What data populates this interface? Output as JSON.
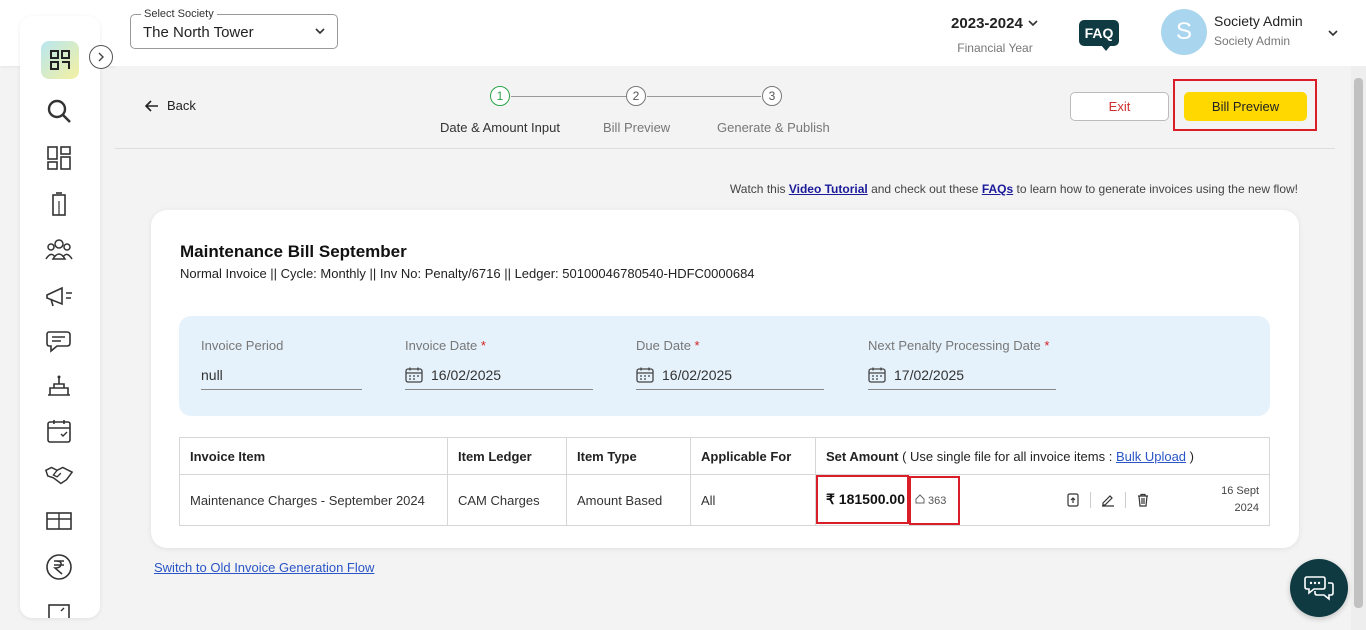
{
  "header": {
    "society_label": "Select Society",
    "society_value": "The North Tower",
    "financial_year": "2023-2024",
    "financial_year_label": "Financial Year",
    "faq_label": "FAQ",
    "avatar_letter": "S",
    "user_name": "Society Admin",
    "user_role": "Society Admin"
  },
  "sidebar": {
    "icons": [
      "search-icon",
      "dashboard-icon",
      "building-icon",
      "people-icon",
      "announcement-icon",
      "chat-icon",
      "amenity-icon",
      "calendar-icon",
      "handshake-icon",
      "parcel-icon",
      "rupee-icon",
      "more-icon"
    ]
  },
  "nav": {
    "back_label": "Back",
    "steps": [
      {
        "number": "1",
        "label": "Date & Amount Input"
      },
      {
        "number": "2",
        "label": "Bill Preview"
      },
      {
        "number": "3",
        "label": "Generate & Publish"
      }
    ],
    "exit_label": "Exit",
    "bill_preview_label": "Bill Preview"
  },
  "tutorial": {
    "prefix": "Watch this ",
    "video_link": "Video Tutorial",
    "middle": " and check out these ",
    "faq_link": "FAQs",
    "suffix": " to learn how to generate invoices using the new flow!"
  },
  "invoice": {
    "title": "Maintenance Bill September",
    "subtitle": "Normal Invoice || Cycle: Monthly || Inv No: Penalty/6716 || Ledger: 50100046780540-HDFC0000684",
    "fields": {
      "period_label": "Invoice Period",
      "period_value": "null",
      "invoice_date_label": "Invoice Date",
      "invoice_date_value": "16/02/2025",
      "due_date_label": "Due Date",
      "due_date_value": "16/02/2025",
      "penalty_date_label": "Next Penalty Processing Date",
      "penalty_date_value": "17/02/2025",
      "required_mark": "*"
    },
    "table": {
      "headers": {
        "item": "Invoice Item",
        "ledger": "Item Ledger",
        "type": "Item Type",
        "applicable": "Applicable For",
        "amount": "Set Amount",
        "amount_note": " ( Use single file for all invoice items : ",
        "bulk_upload": "Bulk Upload",
        "amount_note_end": " )"
      },
      "rows": [
        {
          "item": "Maintenance Charges - September 2024",
          "ledger": "CAM Charges",
          "type": "Amount Based",
          "applicable": "All",
          "amount": "₹ 181500.00",
          "units": "363",
          "date_line1": "16 Sept",
          "date_line2": "2024"
        }
      ]
    }
  },
  "old_flow_link": "Switch to Old Invoice Generation Flow"
}
